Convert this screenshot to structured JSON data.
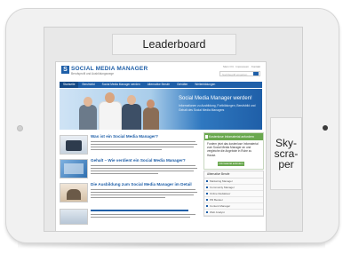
{
  "ads": {
    "leaderboard": "Leaderboard",
    "skyscraper": "Sky-\nscra-\nper"
  },
  "site": {
    "logo_mark": "S",
    "logo_title": "SOCIAL MEDIA MANAGER",
    "logo_sub": "Berufsprofil und Ausbildungswege",
    "toplinks": "Mein Ort · Impressum · Kontakt",
    "search_placeholder": "Suchbegriff eingeben"
  },
  "nav": [
    "Startseite",
    "Berufsbild",
    "Social Media Manager werden",
    "Alternative Berufe",
    "Gehälter",
    "Weiterbildungen"
  ],
  "hero": {
    "title": "Social Media Manager werden!",
    "text": "Informationen zu Ausbildung, Fortbildungen, Berufsbild und Gehalt des Social Media Managers"
  },
  "articles": [
    {
      "title": "Was ist ein Social Media Manager?"
    },
    {
      "title": "Gehalt – Wie verdient ein Social Media Manager?"
    },
    {
      "title": "Die Ausbildung zum Social Media Manager im Detail"
    }
  ],
  "sidebox": {
    "head": "Kostenlose Infomaterial anfordern",
    "text": "Fordern jetzt das kostenlose Infomaterial zum Social Media Manager an und vergleiche die Angebote in Ruhe zu Hause.",
    "button": "Infomaterial anfordern"
  },
  "sidelist": {
    "head": "Alternative Berufe",
    "items": [
      "Marketing Manager",
      "Community Manager",
      "Online Redakteur",
      "PR Berater",
      "Content Manager",
      "Web Analyst"
    ]
  },
  "colors": {
    "brand": "#1f5fa8",
    "accent_green": "#6aa84f"
  }
}
